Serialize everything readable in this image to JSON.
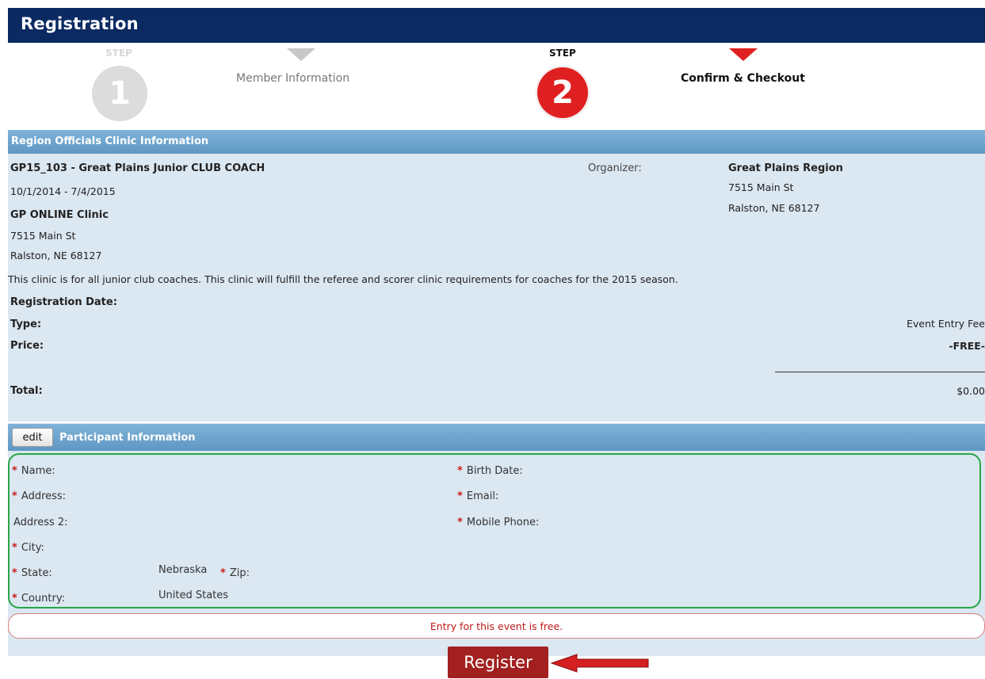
{
  "header": {
    "title": "Registration"
  },
  "steps": [
    {
      "word": "STEP",
      "number": "1",
      "label": "Member Information",
      "state": "inactive"
    },
    {
      "word": "STEP",
      "number": "2",
      "label": "Confirm & Checkout",
      "state": "active"
    }
  ],
  "event_section": {
    "title": "Region Officials Clinic Information",
    "event_name": "GP15_103 - Great Plains Junior CLUB COACH",
    "dates": "10/1/2014 - 7/4/2015",
    "venue_name": "GP ONLINE Clinic",
    "venue_street": "7515 Main St",
    "venue_city": "Ralston, NE  68127",
    "organizer_label": "Organizer:",
    "organizer_name": "Great Plains Region",
    "organizer_street": "7515 Main St",
    "organizer_city": "Ralston, NE  68127",
    "description": "This clinic is for all junior club coaches. This clinic will fulfill the referee and scorer clinic requirements for coaches for the 2015 season.",
    "registration_date_label": "Registration Date:",
    "type_label": "Type:",
    "type_value": "Event Entry Fee",
    "price_label": "Price:",
    "price_value": "-FREE-",
    "total_label": "Total:",
    "total_value": "$0.00"
  },
  "participant_section": {
    "edit_label": "edit",
    "title": "Participant Information",
    "fields_left": [
      {
        "label": "Name:",
        "required": true,
        "value": ""
      },
      {
        "label": "Address:",
        "required": true,
        "value": ""
      },
      {
        "label": "Address 2:",
        "required": false,
        "value": ""
      },
      {
        "label": "City:",
        "required": true,
        "value": ""
      },
      {
        "label": "State:",
        "required": true,
        "value": "Nebraska"
      },
      {
        "label": "Country:",
        "required": true,
        "value": "United States"
      }
    ],
    "zip_label": "Zip:",
    "fields_right": [
      {
        "label": "Birth Date:",
        "required": true
      },
      {
        "label": "Email:",
        "required": true
      },
      {
        "label": "Mobile Phone:",
        "required": true
      }
    ],
    "required_marker": "*"
  },
  "free_notice": "Entry for this event is free.",
  "register_label": "Register",
  "colors": {
    "header_bg": "#0b2a62",
    "active_step": "#e02020",
    "inactive_step": "#d6d6d6",
    "section_bar": "#6aa3cd",
    "panel_bg": "#dbe7f1",
    "valid_border": "#2aa646",
    "register_bg": "#a32020",
    "arrow": "#d42020"
  }
}
